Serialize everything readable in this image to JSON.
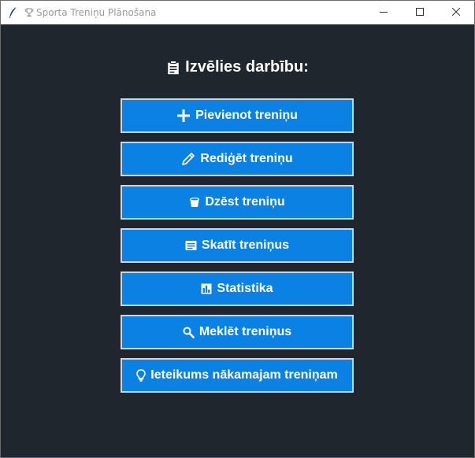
{
  "window": {
    "title": "Sporta Treniņu Plānošana",
    "app_icon": "feather-icon",
    "title_icon": "trophy-icon",
    "controls": [
      "minimize-icon",
      "maximize-icon",
      "close-icon"
    ]
  },
  "main": {
    "heading": "Izvēlies darbību:",
    "heading_icon": "clipboard-icon",
    "buttons": [
      {
        "label": "Pievienot treniņu",
        "icon": "plus-icon"
      },
      {
        "label": "Rediģēt treniņu",
        "icon": "pencil-icon"
      },
      {
        "label": "Dzēst treniņu",
        "icon": "trash-icon"
      },
      {
        "label": "Skatīt treniņus",
        "icon": "list-icon"
      },
      {
        "label": "Statistika",
        "icon": "bar-chart-icon"
      },
      {
        "label": "Meklēt treniņus",
        "icon": "magnifier-icon"
      },
      {
        "label": "Ieteikums nākamajam treniņam",
        "icon": "lightbulb-icon"
      }
    ]
  },
  "colors": {
    "background": "#1f262e",
    "button": "#0b82e3",
    "button_border": "#c9d6e3",
    "text": "#ffffff"
  }
}
